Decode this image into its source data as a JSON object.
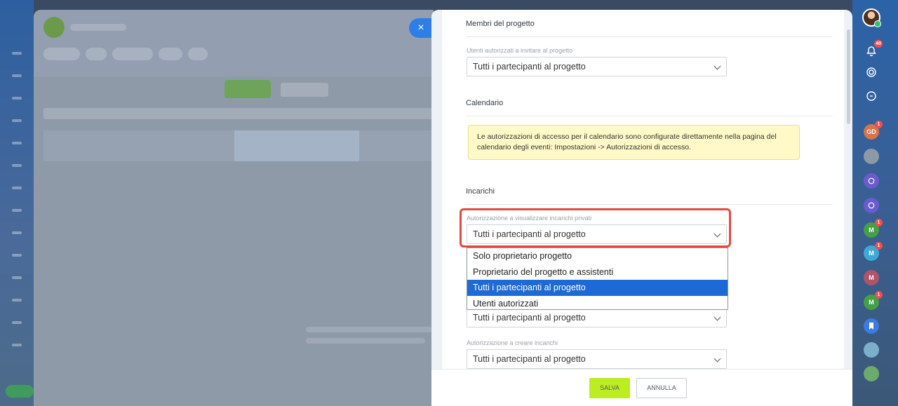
{
  "panel": {
    "sections": [
      {
        "title": "Membri del progetto",
        "field_label": "Utenti autorizzati a invitare al progetto",
        "field_value": "Tutti i partecipanti al progetto"
      },
      {
        "title": "Calendario",
        "notice": "Le autorizzazioni di accesso per il calendario sono configurate direttamente nella pagina del calendario degli eventi: Impostazioni -> Autorizzazioni di accesso."
      },
      {
        "title": "Incarichi",
        "field_label": "Autorizzazione a visualizzare incarichi privati",
        "field_value": "Tutti i partecipanti al progetto"
      }
    ],
    "dropdown_options": [
      "Solo proprietario progetto",
      "Proprietario del progetto e assistenti",
      "Tutti i partecipanti al progetto",
      "Utenti autorizzati"
    ],
    "dropdown_selected_index": 2,
    "hidden_field_value": "Tutti i partecipanti al progetto",
    "create_tasks": {
      "field_label": "Autorizzazione a creare incarichi",
      "field_value": "Tutti i partecipanti al progetto"
    },
    "footer": {
      "save_label": "SALVA",
      "cancel_label": "ANNULLA"
    }
  },
  "close_icon_glyph": "×",
  "right_sidebar": {
    "notifications_badge": "40",
    "items": [
      {
        "initials": "GD",
        "badge": "1",
        "color": "#d9734a"
      },
      {
        "initials": "",
        "badge": "",
        "color": "#8d9aa6"
      },
      {
        "initials": "",
        "badge": "",
        "color": "#6a5bcf"
      },
      {
        "initials": "",
        "badge": "",
        "color": "#6a5bcf"
      },
      {
        "initials": "M",
        "badge": "1",
        "color": "#43a047"
      },
      {
        "initials": "M",
        "badge": "1",
        "color": "#3fa9d6"
      },
      {
        "initials": "M",
        "badge": "",
        "color": "#b0546a"
      },
      {
        "initials": "M",
        "badge": "1",
        "color": "#43a047"
      },
      {
        "initials": "",
        "badge": "",
        "color": "#3c7be0"
      },
      {
        "initials": "",
        "badge": "",
        "color": "#7ab0c9"
      },
      {
        "initials": "",
        "badge": "",
        "color": "#6bab6b"
      }
    ]
  },
  "colors": {
    "accent_blue": "#2d7ee8",
    "save_green": "#bbed21",
    "highlight_red": "#e8473d",
    "selected_option": "#1d6ad6"
  }
}
